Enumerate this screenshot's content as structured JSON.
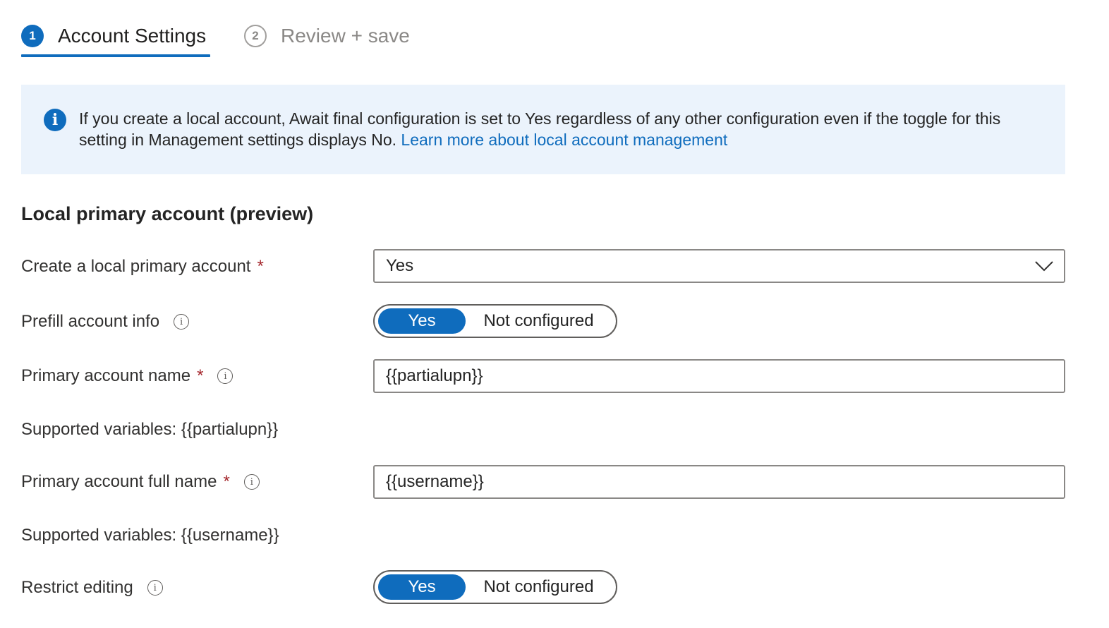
{
  "tabs": [
    {
      "number": "1",
      "label": "Account Settings",
      "active": true
    },
    {
      "number": "2",
      "label": "Review + save",
      "active": false
    }
  ],
  "info": {
    "icon": "info-icon",
    "text": "If you create a local account, Await final configuration is set to Yes regardless of any other configuration even if the toggle for this setting in Management settings displays No.",
    "link": "Learn more about local account management"
  },
  "section": {
    "title": "Local primary account (preview)"
  },
  "fields": {
    "create_local": {
      "label": "Create a local primary account",
      "required": "*",
      "value": "Yes"
    },
    "prefill": {
      "label": "Prefill account info",
      "on_label": "Yes",
      "off_label": "Not configured"
    },
    "account_name": {
      "label": "Primary account name",
      "required": "*",
      "value": "{{partialupn}}",
      "hint": "Supported variables: {{partialupn}}"
    },
    "full_name": {
      "label": "Primary account full name",
      "required": "*",
      "value": "{{username}}",
      "hint": "Supported variables: {{username}}"
    },
    "restrict": {
      "label": "Restrict editing",
      "on_label": "Yes",
      "off_label": "Not configured"
    }
  },
  "colors": {
    "accent": "#0f6cbd",
    "banner_bg": "#ebf3fc",
    "required": "#a4262c"
  }
}
